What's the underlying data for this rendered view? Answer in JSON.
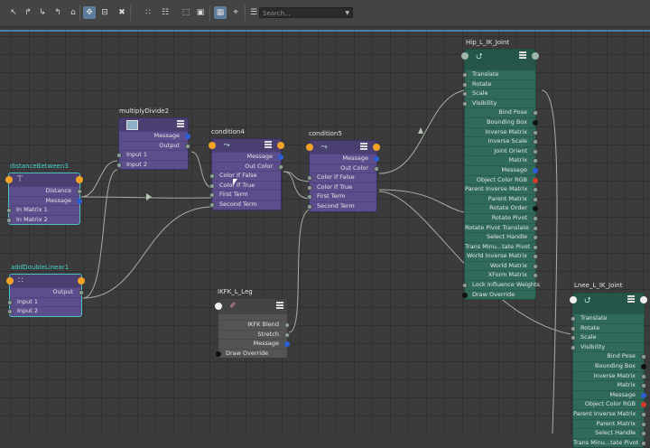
{
  "toolbar": {
    "search_placeholder": "Search...",
    "buttons": [
      "select-icon",
      "graph-icon",
      "graph-down-icon",
      "graph-up-icon",
      "home-icon",
      "add-selected-icon",
      "remove-selected-icon",
      "clear-icon",
      "layout-icon",
      "grid-icon",
      "frame-selected-icon",
      "frame-all-icon",
      "show-attributes-icon",
      "pin-icon",
      "filter-icon",
      "mute-icon"
    ]
  },
  "nodes": {
    "distanceBetween": {
      "title": "distanceBetween3",
      "rows": [
        "Distance",
        "Message",
        "In Matrix 1",
        "In Matrix 2"
      ]
    },
    "addDoubleLinear": {
      "title": "addDoubleLinear1",
      "rows": [
        "Output",
        "Input 1",
        "Input 2"
      ]
    },
    "multiplyDivide": {
      "title": "multiplyDivide2",
      "rows": [
        "Message",
        "Output",
        "Input 1",
        "Input 2"
      ]
    },
    "condition4": {
      "title": "condition4",
      "rows": [
        "Message",
        "Out Color",
        "Color If False",
        "Color If True",
        "First Term",
        "Second Term"
      ]
    },
    "condition5": {
      "title": "condition5",
      "rows": [
        "Message",
        "Out Color",
        "Color If False",
        "Color If True",
        "First Term",
        "Second Term"
      ]
    },
    "ikfk": {
      "title": "IKFK_L_Leg",
      "rows": [
        "IKFK Blend",
        "Stretch",
        "Message",
        "Draw Override"
      ]
    },
    "hip": {
      "title": "Hip_L_IK_Joint",
      "rows": [
        "Translate",
        "Rotate",
        "Scale",
        "Visibility",
        "Bind Pose",
        "Bounding Box",
        "Inverse Matrix",
        "Inverse Scale",
        "Joint Orient",
        "Matrix",
        "Message",
        "Object Color RGB",
        "Parent Inverse Matrix",
        "Parent Matrix",
        "Rotate Order",
        "Rotate Pivot",
        "Rotate Pivot Translate",
        "Select Handle",
        "Trans Minu...tate Pivot",
        "World Inverse Matrix",
        "World Matrix",
        "XForm Matrix",
        "Lock Influence Weights",
        "Draw Override"
      ]
    },
    "knee": {
      "title": "Lnee_L_IK_Joint",
      "rows": [
        "Translate",
        "Rotate",
        "Scale",
        "Visibility",
        "Bind Pose",
        "Bounding Box",
        "Inverse Matrix",
        "Matrix",
        "Message",
        "Object Color RGB",
        "Parent Inverse Matrix",
        "Parent Matrix",
        "Select Handle",
        "Trans Minu...tate Pivot"
      ]
    }
  },
  "colors": {
    "purple": "#5c4e8c",
    "green": "#2f6a5b",
    "grey": "#545454",
    "selection": "#49c3c0",
    "wire": "#b8c4b4",
    "accent": "#4b7ea5"
  }
}
